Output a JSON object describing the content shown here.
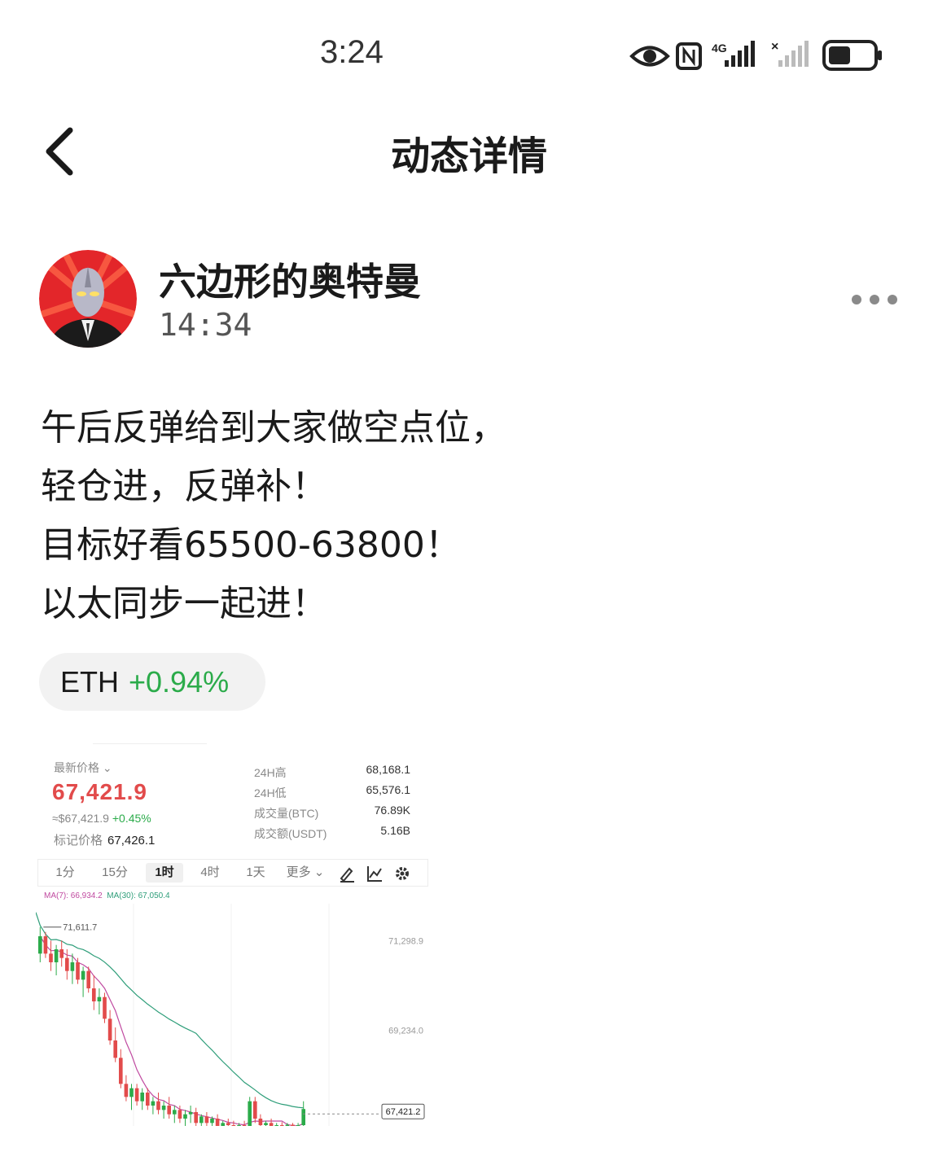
{
  "status_bar": {
    "time": "3:24",
    "network": "4G",
    "icons": [
      "eye-icon",
      "nfc-icon",
      "signal-icon",
      "no-signal-icon",
      "battery-icon"
    ]
  },
  "header": {
    "back_icon": "chevron-left-icon",
    "title": "动态详情"
  },
  "post": {
    "author": "六边形的奥特曼",
    "time": "14:34",
    "more_icon": "more-dots-icon",
    "lines": [
      "午后反弹给到大家做空点位，",
      "轻仓进，反弹补！",
      "目标好看65500-63800！",
      "以太同步一起进！"
    ],
    "coin_tag": {
      "symbol": "ETH",
      "change": "+0.94%",
      "color": "#2bab4a"
    }
  },
  "embed": {
    "last_price_label": "最新价格",
    "last_price": "67,421.9",
    "approx": "≈$67,421.9",
    "approx_change": "+0.45%",
    "mark_label": "标记价格",
    "mark_price": "67,426.1",
    "stats": [
      {
        "label": "24H高",
        "value": "68,168.1"
      },
      {
        "label": "24H低",
        "value": "65,576.1"
      },
      {
        "label": "成交量(BTC)",
        "value": "76.89K"
      },
      {
        "label": "成交额(USDT)",
        "value": "5.16B"
      }
    ],
    "tabs": [
      "1分",
      "15分",
      "1时",
      "4时",
      "1天",
      "更多"
    ],
    "active_tab": "1时",
    "ma7": "MA(7): 66,934.2",
    "ma30": "MA(30): 67,050.4",
    "colors": {
      "up": "#2bab4a",
      "down": "#e24b4b",
      "ma7": "#c04aa0",
      "ma30": "#2f9e7a"
    },
    "chart_data": {
      "type": "candlestick",
      "price_labels": [
        "71,298.9",
        "69,234.0"
      ],
      "high_marker": "71,611.7",
      "current_price": "67,421.2",
      "ylim": [
        66900,
        72000
      ],
      "candles": [
        [
          71000,
          71611.7,
          70800,
          71400
        ],
        [
          71400,
          71500,
          70900,
          71000
        ],
        [
          71000,
          71300,
          70600,
          70800
        ],
        [
          70800,
          71200,
          70500,
          71100
        ],
        [
          71100,
          71300,
          70700,
          70900
        ],
        [
          70900,
          71100,
          70400,
          70600
        ],
        [
          70600,
          71000,
          70300,
          70800
        ],
        [
          70800,
          70900,
          70300,
          70400
        ],
        [
          70400,
          70700,
          70000,
          70600
        ],
        [
          70600,
          70700,
          70100,
          70200
        ],
        [
          70200,
          70500,
          69700,
          69900
        ],
        [
          69900,
          70200,
          69600,
          70000
        ],
        [
          70000,
          70100,
          69400,
          69500
        ],
        [
          69500,
          69700,
          68900,
          69000
        ],
        [
          69000,
          69300,
          68500,
          68600
        ],
        [
          68600,
          68800,
          67900,
          68000
        ],
        [
          68000,
          68200,
          67600,
          67700
        ],
        [
          67700,
          68000,
          67400,
          67900
        ],
        [
          67900,
          68000,
          67500,
          67600
        ],
        [
          67600,
          67900,
          67400,
          67800
        ],
        [
          67800,
          67900,
          67400,
          67500
        ],
        [
          67500,
          67700,
          67300,
          67600
        ],
        [
          67600,
          67800,
          67300,
          67400
        ],
        [
          67400,
          67600,
          67200,
          67500
        ],
        [
          67500,
          67700,
          67200,
          67300
        ],
        [
          67300,
          67500,
          67100,
          67400
        ],
        [
          67400,
          67500,
          67100,
          67200
        ],
        [
          67200,
          67400,
          67000,
          67300
        ],
        [
          67300,
          67500,
          67100,
          67350
        ],
        [
          67350,
          67450,
          67000,
          67100
        ],
        [
          67100,
          67300,
          66950,
          67250
        ],
        [
          67250,
          67350,
          67000,
          67100
        ],
        [
          67100,
          67250,
          66950,
          67200
        ],
        [
          67200,
          67300,
          66900,
          67000
        ],
        [
          67000,
          67150,
          66900,
          67100
        ],
        [
          67100,
          67200,
          66950,
          67050
        ],
        [
          67050,
          67150,
          66900,
          67000
        ],
        [
          67000,
          67100,
          66900,
          67050
        ],
        [
          67050,
          67150,
          66950,
          67000
        ],
        [
          67000,
          67700,
          66950,
          67600
        ],
        [
          67600,
          67700,
          67100,
          67200
        ],
        [
          67200,
          67300,
          66950,
          67050
        ],
        [
          67050,
          67150,
          66950,
          67100
        ],
        [
          67100,
          67200,
          66950,
          67000
        ],
        [
          67000,
          67100,
          66900,
          67050
        ],
        [
          67050,
          67120,
          66950,
          67000
        ],
        [
          67000,
          67100,
          66950,
          67060
        ],
        [
          67060,
          67100,
          66950,
          67000
        ],
        [
          67000,
          67100,
          66950,
          67050
        ],
        [
          67050,
          67600,
          67000,
          67421.2
        ]
      ]
    }
  }
}
